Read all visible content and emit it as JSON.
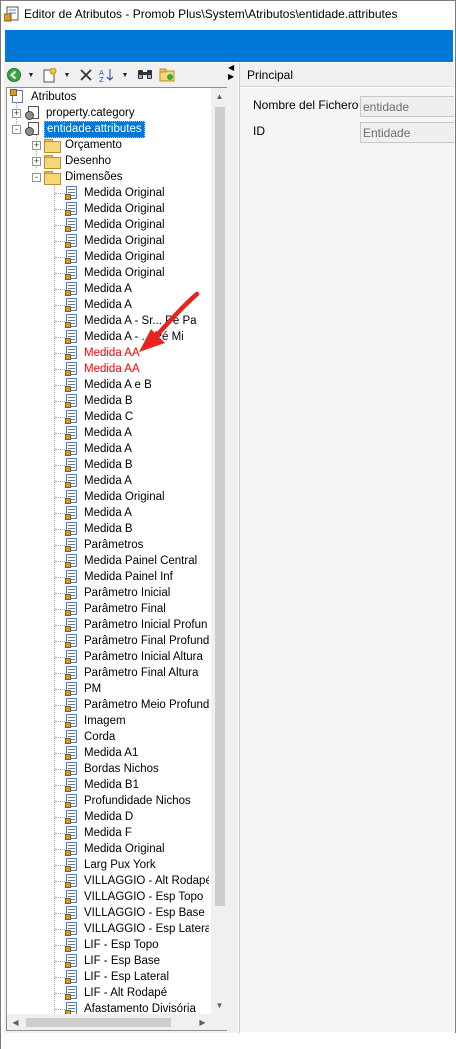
{
  "window": {
    "title": "Editor de Atributos - Promob Plus\\System\\Atributos\\entidade.attributes",
    "accent_color": "#0078d7"
  },
  "toolbar": {
    "buttons": [
      "back-icon",
      "new-attribute-icon",
      "delete-icon",
      "sort-az-icon",
      "find-icon",
      "refresh-folders-icon"
    ]
  },
  "tree": {
    "root": "Atributos",
    "items": [
      {
        "label": "property.category",
        "level": 1,
        "type": "entity",
        "expander": "+"
      },
      {
        "label": "entidade.attributes",
        "level": 1,
        "type": "entity",
        "expander": "-",
        "selected": true
      },
      {
        "label": "Orçamento",
        "level": 2,
        "type": "folder",
        "expander": "+"
      },
      {
        "label": "Desenho",
        "level": 2,
        "type": "folder",
        "expander": "+"
      },
      {
        "label": "Dimensões",
        "level": 2,
        "type": "folder",
        "expander": "-"
      },
      {
        "label": "Medida Original",
        "level": 3,
        "type": "attr"
      },
      {
        "label": "Medida Original",
        "level": 3,
        "type": "attr"
      },
      {
        "label": "Medida Original",
        "level": 3,
        "type": "attr"
      },
      {
        "label": "Medida Original",
        "level": 3,
        "type": "attr"
      },
      {
        "label": "Medida Original",
        "level": 3,
        "type": "attr"
      },
      {
        "label": "Medida Original",
        "level": 3,
        "type": "attr"
      },
      {
        "label": "Medida A",
        "level": 3,
        "type": "attr"
      },
      {
        "label": "Medida A",
        "level": 3,
        "type": "attr"
      },
      {
        "label": "Medida A - Sr... Pé Pa",
        "level": 3,
        "type": "attr"
      },
      {
        "label": "Medida A - ... Pé Mi",
        "level": 3,
        "type": "attr"
      },
      {
        "label": "Medida AA",
        "level": 3,
        "type": "attr",
        "red": true
      },
      {
        "label": "Medida AA",
        "level": 3,
        "type": "attr",
        "red": true
      },
      {
        "label": "Medida A e B",
        "level": 3,
        "type": "attr"
      },
      {
        "label": "Medida B",
        "level": 3,
        "type": "attr"
      },
      {
        "label": "Medida C",
        "level": 3,
        "type": "attr"
      },
      {
        "label": "Medida A",
        "level": 3,
        "type": "attr"
      },
      {
        "label": "Medida A",
        "level": 3,
        "type": "attr"
      },
      {
        "label": "Medida B",
        "level": 3,
        "type": "attr"
      },
      {
        "label": "Medida A",
        "level": 3,
        "type": "attr"
      },
      {
        "label": "Medida Original",
        "level": 3,
        "type": "attr"
      },
      {
        "label": "Medida A",
        "level": 3,
        "type": "attr"
      },
      {
        "label": "Medida B",
        "level": 3,
        "type": "attr"
      },
      {
        "label": "Parâmetros",
        "level": 3,
        "type": "attr"
      },
      {
        "label": "Medida Painel Central",
        "level": 3,
        "type": "attr"
      },
      {
        "label": "Medida Painel Inf",
        "level": 3,
        "type": "attr"
      },
      {
        "label": "Parâmetro Inicial",
        "level": 3,
        "type": "attr"
      },
      {
        "label": "Parâmetro Final",
        "level": 3,
        "type": "attr"
      },
      {
        "label": "Parâmetro Inicial Profun",
        "level": 3,
        "type": "attr"
      },
      {
        "label": "Parâmetro Final Profund",
        "level": 3,
        "type": "attr"
      },
      {
        "label": "Parâmetro Inicial Altura",
        "level": 3,
        "type": "attr"
      },
      {
        "label": "Parâmetro Final Altura",
        "level": 3,
        "type": "attr"
      },
      {
        "label": "PM",
        "level": 3,
        "type": "attr"
      },
      {
        "label": "Parâmetro Meio Profund",
        "level": 3,
        "type": "attr"
      },
      {
        "label": "Imagem",
        "level": 3,
        "type": "attr"
      },
      {
        "label": "Corda",
        "level": 3,
        "type": "attr"
      },
      {
        "label": "Medida A1",
        "level": 3,
        "type": "attr"
      },
      {
        "label": "Bordas Nichos",
        "level": 3,
        "type": "attr"
      },
      {
        "label": "Medida B1",
        "level": 3,
        "type": "attr"
      },
      {
        "label": "Profundidade Nichos",
        "level": 3,
        "type": "attr"
      },
      {
        "label": "Medida D",
        "level": 3,
        "type": "attr"
      },
      {
        "label": "Medida F",
        "level": 3,
        "type": "attr"
      },
      {
        "label": "Medida Original",
        "level": 3,
        "type": "attr"
      },
      {
        "label": "Larg Pux York",
        "level": 3,
        "type": "attr"
      },
      {
        "label": "VILLAGGIO - Alt Rodapé",
        "level": 3,
        "type": "attr"
      },
      {
        "label": "VILLAGGIO - Esp Topo",
        "level": 3,
        "type": "attr"
      },
      {
        "label": "VILLAGGIO - Esp Base",
        "level": 3,
        "type": "attr"
      },
      {
        "label": "VILLAGGIO - Esp Lateral",
        "level": 3,
        "type": "attr"
      },
      {
        "label": "LIF - Esp Topo",
        "level": 3,
        "type": "attr"
      },
      {
        "label": "LIF - Esp Base",
        "level": 3,
        "type": "attr"
      },
      {
        "label": "LIF - Esp Lateral",
        "level": 3,
        "type": "attr"
      },
      {
        "label": "LIF - Alt Rodapé",
        "level": 3,
        "type": "attr"
      },
      {
        "label": "Afastamento Divisória",
        "level": 3,
        "type": "attr"
      }
    ]
  },
  "properties": {
    "tab_title": "Principal",
    "fields": [
      {
        "label": "Nombre del Fichero",
        "value": "entidade"
      },
      {
        "label": "ID",
        "value": "Entidade"
      }
    ]
  }
}
